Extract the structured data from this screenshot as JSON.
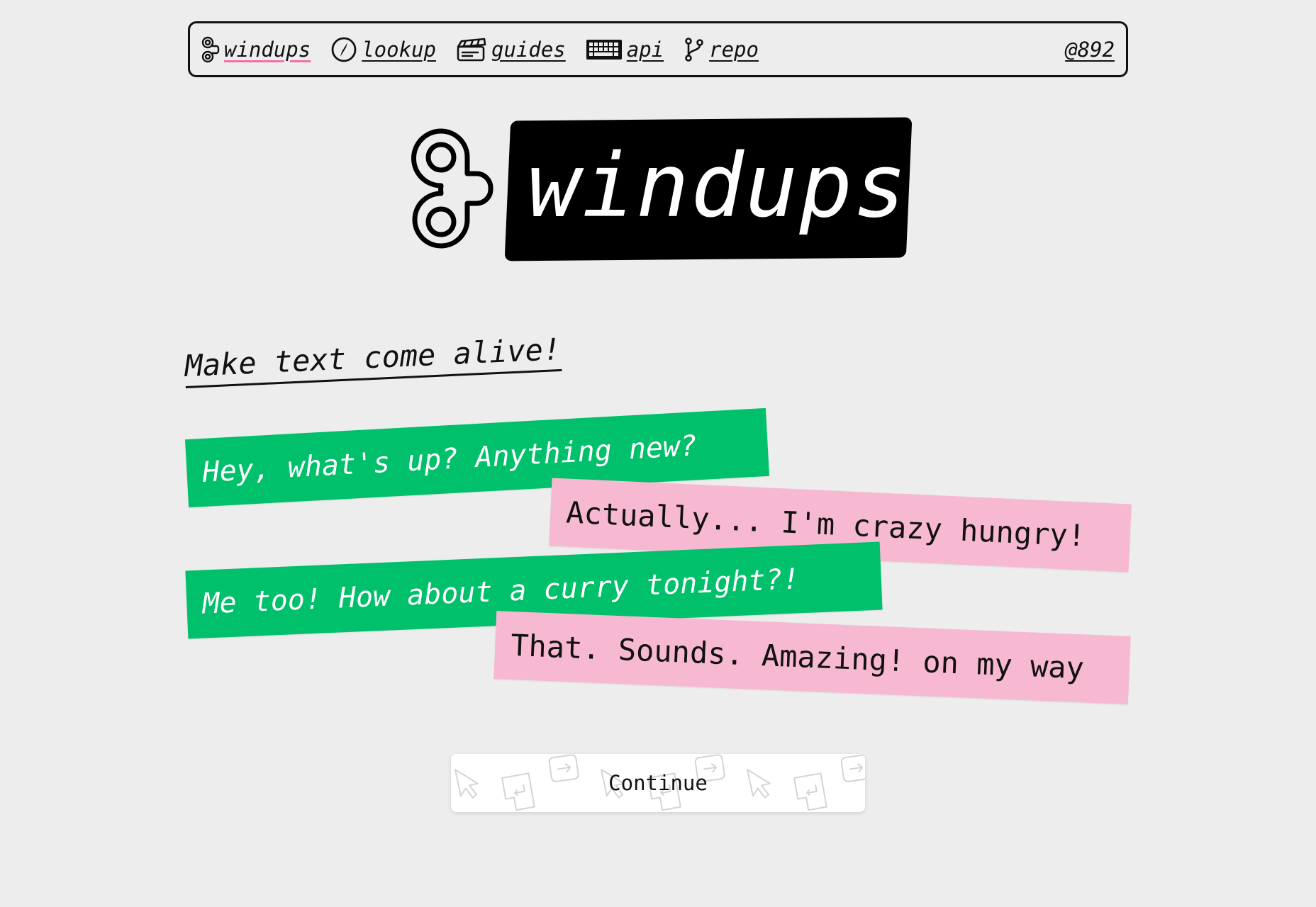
{
  "nav": {
    "items": [
      {
        "label": "windups",
        "icon": "windup-key-icon",
        "active": true
      },
      {
        "label": "lookup",
        "icon": "compass-icon"
      },
      {
        "label": "guides",
        "icon": "clapperboard-icon"
      },
      {
        "label": "api",
        "icon": "keyboard-icon"
      },
      {
        "label": "repo",
        "icon": "git-branch-icon"
      }
    ],
    "handle": "@892"
  },
  "hero": {
    "title": "windups",
    "icon": "windup-key-icon"
  },
  "tagline": "Make text come alive!",
  "chat": [
    {
      "text": "Hey, what's up? Anything new?",
      "color": "#00c06b"
    },
    {
      "text": "Actually... I'm crazy hungry!",
      "color": "#f7b8d2"
    },
    {
      "text": "Me too! How about a curry tonight?!",
      "color": "#00c06b"
    },
    {
      "text": "That. Sounds. Amazing! on my way",
      "color": "#f7b8d2"
    }
  ],
  "continue_button": {
    "label": "Continue",
    "pattern_icons": [
      "cursor-arrow-icon",
      "enter-key-icon",
      "arrow-right-key-icon"
    ]
  },
  "colors": {
    "background": "#ededed",
    "green": "#00c06b",
    "pink": "#f7b8d2",
    "active_underline": "#f06fa9"
  }
}
